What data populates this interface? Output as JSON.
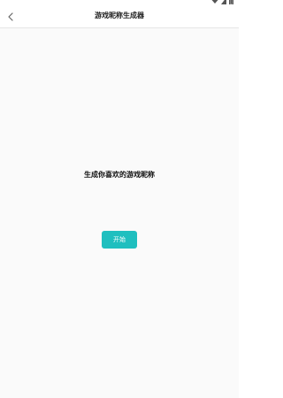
{
  "nav": {
    "title": "游戏昵称生成器",
    "back_icon": "chevron-left-icon"
  },
  "status_bar": {
    "icons": [
      "wifi-icon",
      "signal-icon",
      "battery-icon"
    ]
  },
  "main": {
    "headline": "生成你喜欢的游戏昵称",
    "start_label": "开始"
  },
  "colors": {
    "accent": "#1fbfbf",
    "background": "#fafafa",
    "nav_background": "#ffffff"
  }
}
